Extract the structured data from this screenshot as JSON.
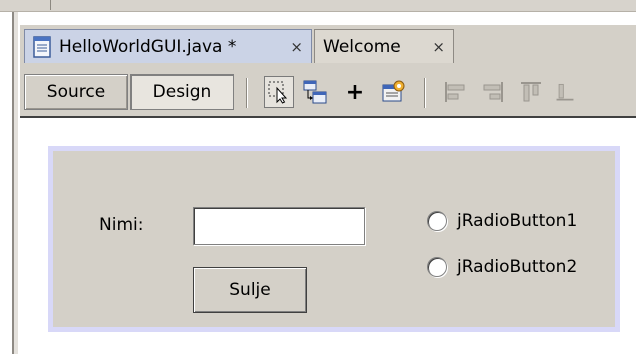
{
  "editor": {
    "tabs": [
      {
        "label": "HelloWorldGUI.java *",
        "close": "×",
        "icon": "java-document-icon",
        "active": true
      },
      {
        "label": "Welcome",
        "close": "×",
        "active": false
      }
    ],
    "modes": {
      "source": "Source",
      "design": "Design"
    },
    "toolbar": {
      "icons": [
        "selection-mode-icon",
        "connection-mode-icon",
        "add-icon",
        "preview-design-icon",
        "align-left-icon",
        "align-right-icon",
        "align-top-icon",
        "align-bottom-icon"
      ],
      "add_glyph": "+"
    }
  },
  "form": {
    "label_nimi": "Nimi:",
    "name_field_value": "",
    "close_button": "Sulje",
    "radio_buttons": [
      {
        "label": "jRadioButton1",
        "selected": false
      },
      {
        "label": "jRadioButton2",
        "selected": false
      }
    ]
  },
  "colors": {
    "chrome": "#d4d0c8",
    "active_tab": "#cbd3e6",
    "selection_border": "#d8d8f8"
  }
}
